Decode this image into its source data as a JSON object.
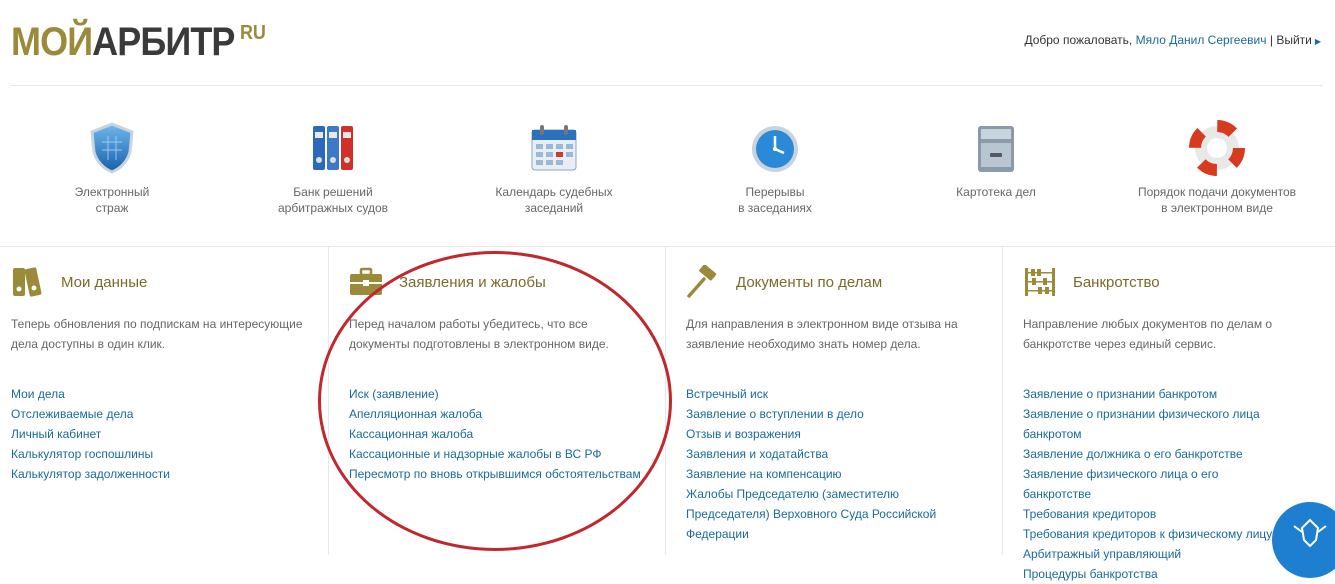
{
  "header": {
    "logo_part1": "МОЙ",
    "logo_part2": "АРБИТР",
    "logo_ru": "RU",
    "welcome_text": "Добро пожаловать,",
    "user_name": "Мяло Данил Сергеевич",
    "divider": "|",
    "logout_label": "Выйти"
  },
  "quick_links": [
    {
      "label": "Электронный\nстраж",
      "icon": "shield-icon"
    },
    {
      "label": "Банк решений\nарбитражных судов",
      "icon": "binders-icon"
    },
    {
      "label": "Календарь судебных\nзаседаний",
      "icon": "calendar-icon"
    },
    {
      "label": "Перерывы\nв заседаниях",
      "icon": "clock-icon"
    },
    {
      "label": "Картотека дел",
      "icon": "file-cabinet-icon"
    },
    {
      "label": "Порядок подачи документов\nв электронном виде",
      "icon": "lifebuoy-icon"
    }
  ],
  "columns": [
    {
      "title": "Мои данные",
      "icon": "folders-icon",
      "description": "Теперь обновления по подпискам на интересующие дела доступны в один клик.",
      "links": [
        "Мои дела",
        "Отслеживаемые дела",
        "Личный кабинет",
        "Калькулятор госпошлины",
        "Калькулятор задолженности"
      ]
    },
    {
      "title": "Заявления и жалобы",
      "icon": "briefcase-icon",
      "description": "Перед началом работы убедитесь, что все документы подготовлены в электронном виде.",
      "links": [
        "Иск (заявление)",
        "Апелляционная жалоба",
        "Кассационная жалоба",
        "Кассационные и надзорные жалобы в ВС РФ",
        "Пересмотр по вновь открывшимся обстоятельствам"
      ]
    },
    {
      "title": "Документы по делам",
      "icon": "gavel-icon",
      "description": "Для направления в электронном виде отзыва на заявление необходимо знать номер дела.",
      "links": [
        "Встречный иск",
        "Заявление о вступлении в дело",
        "Отзыв и возражения",
        "Заявления и ходатайства",
        "Заявление на компенсацию",
        "Жалобы Председателю (заместителю Председателя) Верховного Суда Российской Федерации"
      ]
    },
    {
      "title": "Банкротство",
      "icon": "abacus-icon",
      "description": "Направление любых документов по делам о банкротстве через единый сервис.",
      "links": [
        "Заявление о признании банкротом",
        "Заявление о признании физического лица банкротом",
        "Заявление должника о его банкротстве",
        "Заявление физического лица о его банкротстве",
        "Требования кредиторов",
        "Требования кредиторов к физическому лицу",
        "Арбитражный управляющий",
        "Процедуры банкротства"
      ]
    }
  ],
  "colors": {
    "accent": "#9a8a3a",
    "link": "#1a6a9a",
    "annotation": "#c0282e"
  }
}
